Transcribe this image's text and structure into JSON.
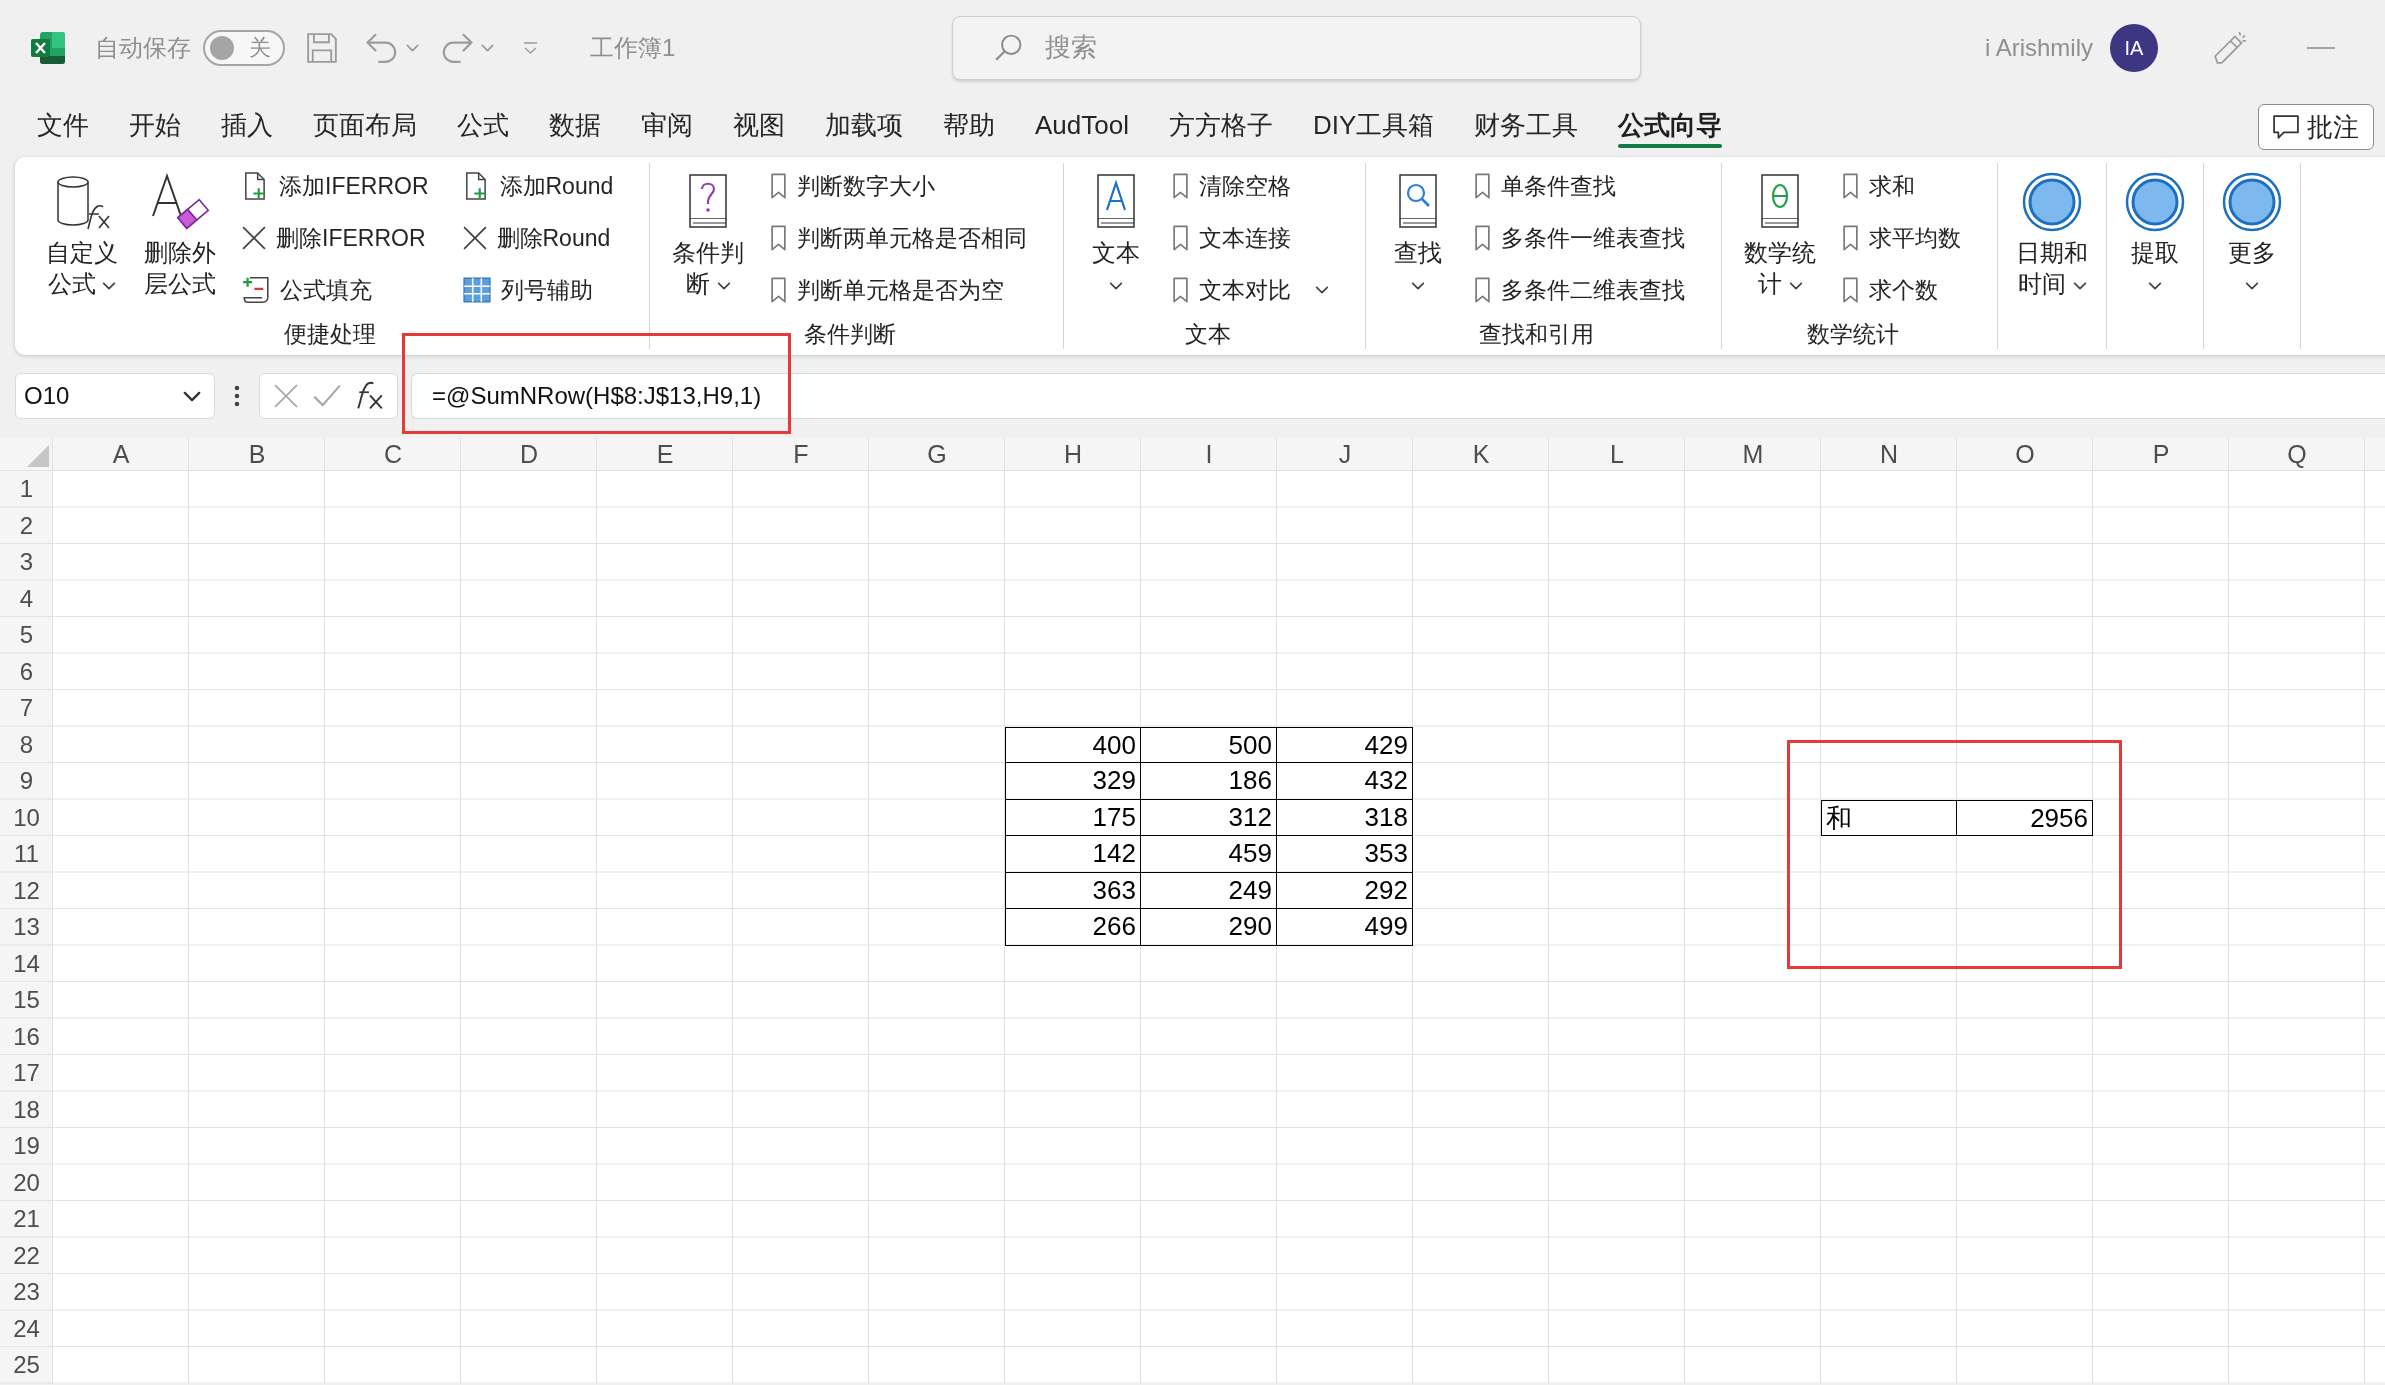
{
  "title_bar": {
    "autosave": {
      "label": "自动保存",
      "toggle_text": "关",
      "on": false
    },
    "document_title": "工作簿1",
    "search": {
      "placeholder": "搜索"
    },
    "user": {
      "name": "i Arishmily",
      "initials": "IA"
    }
  },
  "ribbon_tabs": [
    {
      "label": "文件",
      "selected": false
    },
    {
      "label": "开始",
      "selected": false
    },
    {
      "label": "插入",
      "selected": false
    },
    {
      "label": "页面布局",
      "selected": false
    },
    {
      "label": "公式",
      "selected": false
    },
    {
      "label": "数据",
      "selected": false
    },
    {
      "label": "审阅",
      "selected": false
    },
    {
      "label": "视图",
      "selected": false
    },
    {
      "label": "加载项",
      "selected": false
    },
    {
      "label": "帮助",
      "selected": false
    },
    {
      "label": "AudTool",
      "selected": false
    },
    {
      "label": "方方格子",
      "selected": false
    },
    {
      "label": "DIY工具箱",
      "selected": false
    },
    {
      "label": "财务工具",
      "selected": false
    },
    {
      "label": "公式向导",
      "selected": true
    }
  ],
  "comments_button": {
    "label": "批注"
  },
  "ribbon_groups": [
    {
      "label": "便捷处理",
      "large_buttons": [
        {
          "label_lines": [
            "自定义",
            "公式"
          ],
          "kind": "cylinder",
          "dropdown": true
        },
        {
          "label_lines": [
            "删除外",
            "层公式"
          ],
          "kind": "eraser",
          "dropdown": false
        }
      ],
      "small_columns": [
        [
          {
            "label": "添加IFERROR",
            "kind": "add",
            "dropdown": false
          },
          {
            "label": "删除IFERROR",
            "kind": "remove",
            "dropdown": false
          },
          {
            "label": "公式填充",
            "kind": "fill",
            "dropdown": false
          }
        ],
        [
          {
            "label": "添加Round",
            "kind": "add",
            "dropdown": false
          },
          {
            "label": "删除Round",
            "kind": "remove",
            "dropdown": false
          },
          {
            "label": "列号辅助",
            "kind": "grid",
            "dropdown": false
          }
        ]
      ]
    },
    {
      "label": "条件判断",
      "large_buttons": [
        {
          "label_lines": [
            "条件判",
            "断"
          ],
          "kind": "question",
          "dropdown": true
        }
      ],
      "small_columns": [
        [
          {
            "label": "判断数字大小",
            "kind": "bookmark",
            "dropdown": false
          },
          {
            "label": "判断两单元格是否相同",
            "kind": "bookmark",
            "dropdown": false
          },
          {
            "label": "判断单元格是否为空",
            "kind": "bookmark",
            "dropdown": false
          }
        ]
      ]
    },
    {
      "label": "文本",
      "large_buttons": [
        {
          "label_lines": [
            "文本"
          ],
          "kind": "letter",
          "dropdown": true
        }
      ],
      "small_columns": [
        [
          {
            "label": "清除空格",
            "kind": "bookmark",
            "dropdown": false
          },
          {
            "label": "文本连接",
            "kind": "bookmark",
            "dropdown": false
          },
          {
            "label": "文本对比",
            "kind": "bookmark",
            "dropdown": true
          }
        ]
      ]
    },
    {
      "label": "查找和引用",
      "large_buttons": [
        {
          "label_lines": [
            "查找"
          ],
          "kind": "lens",
          "dropdown": true
        }
      ],
      "small_columns": [
        [
          {
            "label": "单条件查找",
            "kind": "bookmark",
            "dropdown": false
          },
          {
            "label": "多条件一维表查找",
            "kind": "bookmark",
            "dropdown": false
          },
          {
            "label": "多条件二维表查找",
            "kind": "bookmark",
            "dropdown": false
          }
        ]
      ]
    },
    {
      "label": "数学统计",
      "large_buttons": [
        {
          "label_lines": [
            "数学统",
            "计"
          ],
          "kind": "theta",
          "dropdown": true
        }
      ],
      "small_columns": [
        [
          {
            "label": "求和",
            "kind": "bookmark",
            "dropdown": false
          },
          {
            "label": "求平均数",
            "kind": "bookmark",
            "dropdown": false
          },
          {
            "label": "求个数",
            "kind": "bookmark",
            "dropdown": false
          }
        ]
      ]
    },
    {
      "large_buttons": [
        {
          "label_lines": [
            "日期和",
            "时间"
          ],
          "kind": "circle",
          "dropdown": true
        }
      ]
    },
    {
      "large_buttons": [
        {
          "label_lines": [
            "提取"
          ],
          "kind": "circle",
          "dropdown": true
        }
      ]
    },
    {
      "large_buttons": [
        {
          "label_lines": [
            "更多"
          ],
          "kind": "circle",
          "dropdown": true
        }
      ]
    }
  ],
  "formula_bar": {
    "name_box": "O10",
    "formula": "=@SumNRow(H$8:J$13,H9,1)",
    "highlighted": true
  },
  "sheet": {
    "columns": [
      "A",
      "B",
      "C",
      "D",
      "E",
      "F",
      "G",
      "H",
      "I",
      "J",
      "K",
      "L",
      "M",
      "N",
      "O",
      "P",
      "Q"
    ],
    "rows": [
      "1",
      "2",
      "3",
      "4",
      "5",
      "6",
      "7",
      "8",
      "9",
      "10",
      "11",
      "12",
      "13",
      "14",
      "15",
      "16",
      "17",
      "18",
      "19",
      "20",
      "21",
      "22",
      "23",
      "24",
      "25"
    ],
    "tables": [
      {
        "bordered": true,
        "highlighted": false,
        "rows": [
          [
            {
              "value": "400",
              "kind": "number"
            },
            {
              "value": "500",
              "kind": "number"
            },
            {
              "value": "429",
              "kind": "number"
            }
          ],
          [
            {
              "value": "329",
              "kind": "number"
            },
            {
              "value": "186",
              "kind": "number"
            },
            {
              "value": "432",
              "kind": "number"
            }
          ],
          [
            {
              "value": "175",
              "kind": "number"
            },
            {
              "value": "312",
              "kind": "number"
            },
            {
              "value": "318",
              "kind": "number"
            }
          ],
          [
            {
              "value": "142",
              "kind": "number"
            },
            {
              "value": "459",
              "kind": "number"
            },
            {
              "value": "353",
              "kind": "number"
            }
          ],
          [
            {
              "value": "363",
              "kind": "number"
            },
            {
              "value": "249",
              "kind": "number"
            },
            {
              "value": "292",
              "kind": "number"
            }
          ],
          [
            {
              "value": "266",
              "kind": "number"
            },
            {
              "value": "290",
              "kind": "number"
            },
            {
              "value": "499",
              "kind": "number"
            }
          ]
        ]
      },
      {
        "bordered": true,
        "highlighted": true,
        "rows": [
          [
            {
              "value": "和",
              "kind": "text"
            },
            {
              "value": "2956",
              "kind": "number"
            }
          ]
        ]
      }
    ]
  }
}
